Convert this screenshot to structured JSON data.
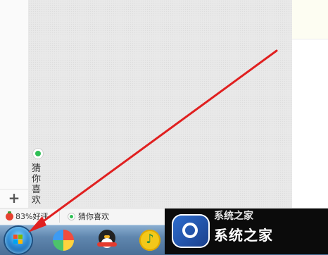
{
  "left_panel": {
    "add_label": "+"
  },
  "guess_tab": {
    "label": "猜你喜欢"
  },
  "status_bar": {
    "rating": "83%好评",
    "guess": "猜你喜欢"
  },
  "taskbar": {
    "start_icon": "windows-start-orb-icon",
    "apps": [
      {
        "icon": "color-ball-app-icon"
      },
      {
        "icon": "qq-penguin-icon"
      },
      {
        "icon": "qq-music-icon"
      }
    ]
  },
  "watermark": {
    "top_text": "系统之家",
    "text": "系统之家"
  },
  "annotation": {
    "color": "#e02020"
  },
  "colors": {
    "green": "#2fbf55",
    "taskbar": "#5f86ae"
  }
}
